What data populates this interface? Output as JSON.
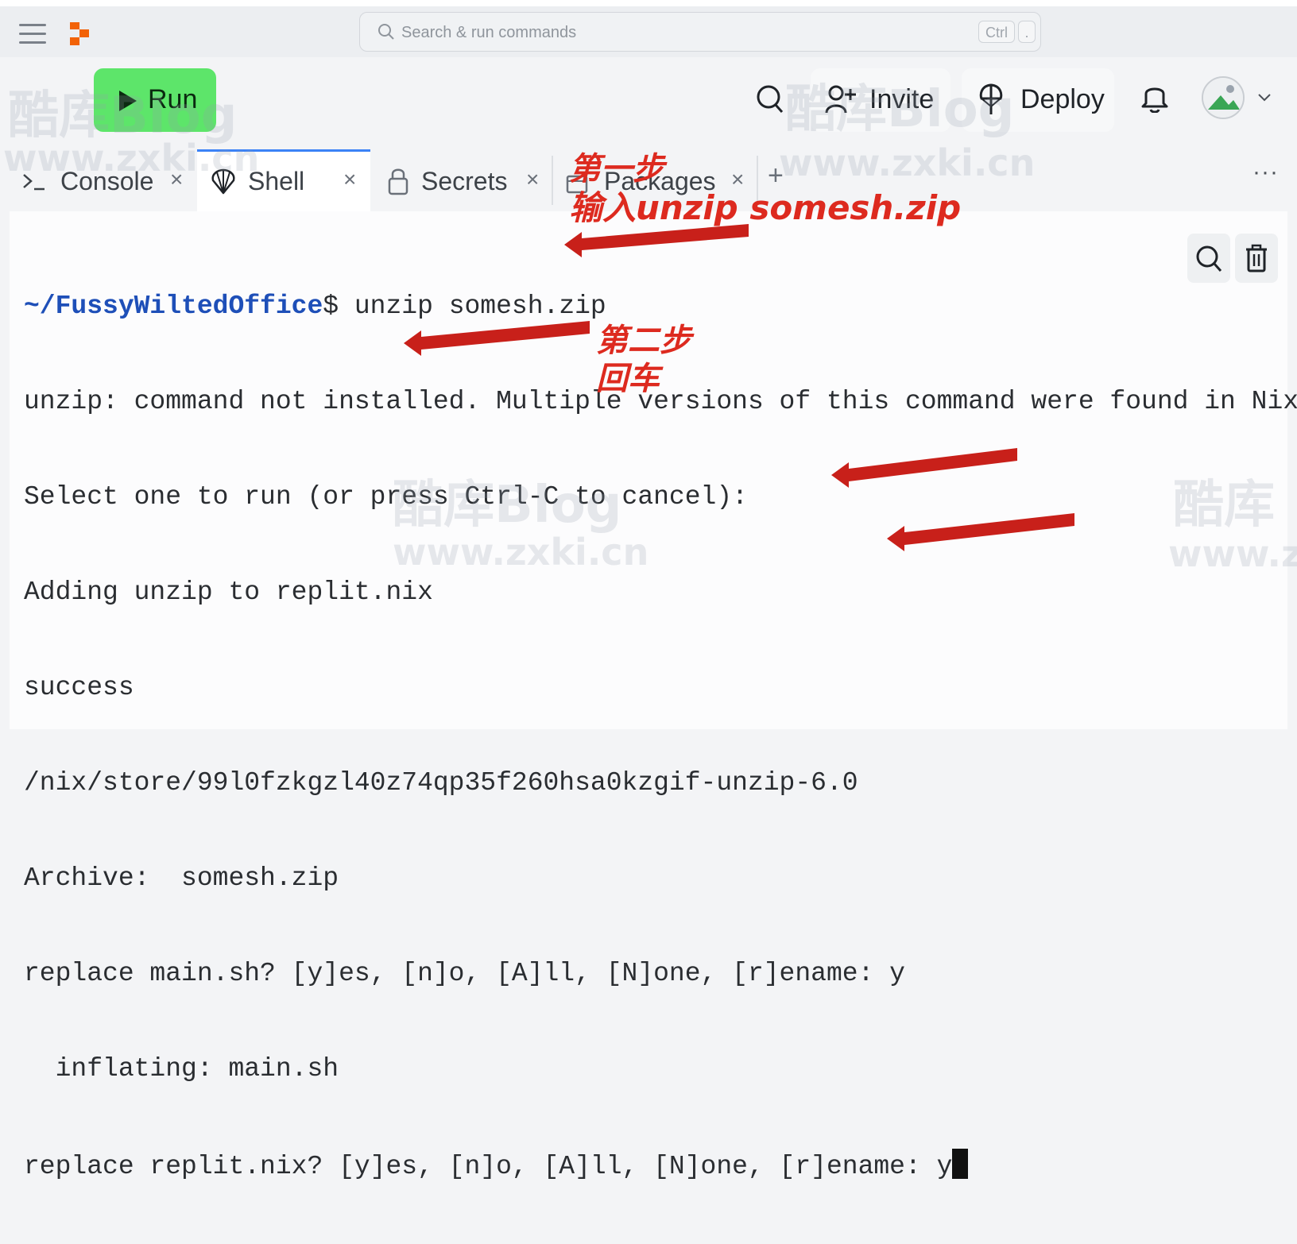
{
  "topbar": {
    "search_placeholder": "Search & run commands",
    "shortcut_key": "Ctrl",
    "shortcut_char": "."
  },
  "toolbar": {
    "run_label": "Run",
    "invite_label": "Invite",
    "deploy_label": "Deploy"
  },
  "tabs": [
    {
      "label": "Console",
      "icon": "console-icon",
      "active": false
    },
    {
      "label": "Shell",
      "icon": "shell-icon",
      "active": true
    },
    {
      "label": "Secrets",
      "icon": "lock-icon",
      "active": false
    },
    {
      "label": "Packages",
      "icon": "package-icon",
      "active": false
    }
  ],
  "tab_close": "×",
  "add_tab": "+",
  "more_label": "···",
  "terminal": {
    "prompt_path": "~/FussyWiltedOffice",
    "prompt_cmd": "$ unzip somesh.zip",
    "lines": [
      "unzip: command not installed. Multiple versions of this command were found in Nix.",
      "Select one to run (or press Ctrl-C to cancel):",
      "Adding unzip to replit.nix",
      "success",
      "/nix/store/99l0fzkgzl40z74qp35f260hsa0kzgif-unzip-6.0",
      "Archive:  somesh.zip",
      "replace main.sh? [y]es, [n]o, [A]ll, [N]one, [r]ename: y",
      "  inflating: main.sh",
      "replace replit.nix? [y]es, [n]o, [A]ll, [N]one, [r]ename: y"
    ]
  },
  "annotations": {
    "step1_title": "第一步",
    "step1_text": "输入unzip somesh.zip",
    "step2_title": "第二步",
    "step2_text": "回车",
    "arrow_color": "#c8201a"
  },
  "watermarks": {
    "blog": "酷库Blog",
    "blog_short": "酷库",
    "url": "www.zxki.cn",
    "url_short": "www.z"
  },
  "colors": {
    "run_green": "#5de56a",
    "active_tab_border": "#3b82f6",
    "prompt_blue": "#1e4fb8",
    "annotation_red": "#dd2a1f"
  }
}
